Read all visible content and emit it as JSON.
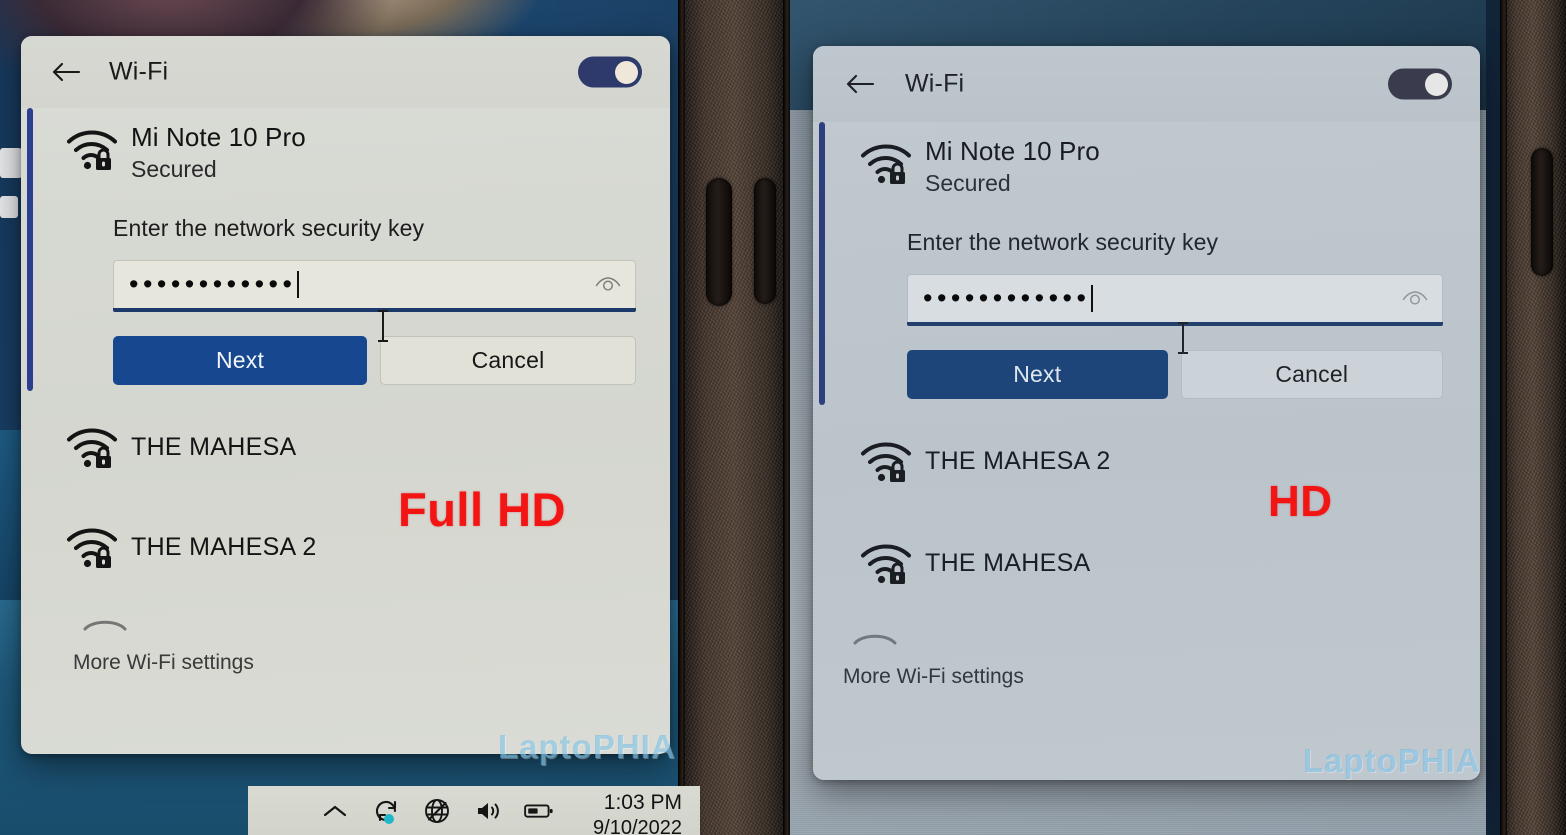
{
  "scene": {
    "description": "Photo comparing two laptop screens showing the Windows 11 Wi-Fi flyout",
    "annotations": [
      {
        "id": "full-hd",
        "label": "Full HD",
        "color": "#f31414"
      },
      {
        "id": "hd",
        "label": "HD",
        "color": "#f31414"
      }
    ],
    "watermark": "LaptoPHIA"
  },
  "panels": [
    {
      "id": "fhd",
      "quality_label": "Full HD",
      "header": {
        "title": "Wi-Fi",
        "back_icon": "back-arrow-icon",
        "toggle": {
          "state": "on",
          "track_color": "#2d3a6b",
          "knob_color": "#efe8da"
        }
      },
      "selected_network": {
        "ssid": "Mi Note 10 Pro",
        "security": "Secured",
        "icon": "wifi-lock-icon",
        "prompt": "Enter the network security key",
        "password": {
          "value": "••••••••••••",
          "dot_count": 12,
          "masked": true,
          "reveal_icon": "eye-icon",
          "focused": true
        },
        "buttons": {
          "primary": "Next",
          "secondary": "Cancel",
          "primary_color": "#17488f"
        }
      },
      "networks": [
        {
          "ssid": "THE MAHESA",
          "icon": "wifi-lock-icon"
        },
        {
          "ssid": "THE MAHESA 2",
          "icon": "wifi-lock-icon"
        }
      ],
      "footer_link": "More Wi-Fi settings"
    },
    {
      "id": "hd",
      "quality_label": "HD",
      "header": {
        "title": "Wi-Fi",
        "back_icon": "back-arrow-icon",
        "toggle": {
          "state": "on",
          "track_color": "#3a3c4d",
          "knob_color": "#e6e6e6"
        }
      },
      "selected_network": {
        "ssid": "Mi Note 10 Pro",
        "security": "Secured",
        "icon": "wifi-lock-icon",
        "prompt": "Enter the network security key",
        "password": {
          "value": "••••••••••••",
          "dot_count": 12,
          "masked": true,
          "reveal_icon": "eye-icon",
          "focused": true
        },
        "buttons": {
          "primary": "Next",
          "secondary": "Cancel",
          "primary_color": "#1d4579"
        }
      },
      "networks": [
        {
          "ssid": "THE MAHESA 2",
          "icon": "wifi-lock-icon"
        },
        {
          "ssid": "THE MAHESA",
          "icon": "wifi-lock-icon"
        }
      ],
      "footer_link": "More Wi-Fi settings"
    }
  ],
  "taskbar": {
    "tray_icons": [
      {
        "name": "show-hidden-icons-chevron",
        "glyph": "chevron-up"
      },
      {
        "name": "onedrive-sync-icon",
        "glyph": "sync"
      },
      {
        "name": "network-no-internet-icon",
        "glyph": "globe"
      },
      {
        "name": "volume-icon",
        "glyph": "speaker"
      },
      {
        "name": "battery-icon",
        "glyph": "battery"
      }
    ],
    "time": "1:03 PM",
    "date": "9/10/2022"
  }
}
